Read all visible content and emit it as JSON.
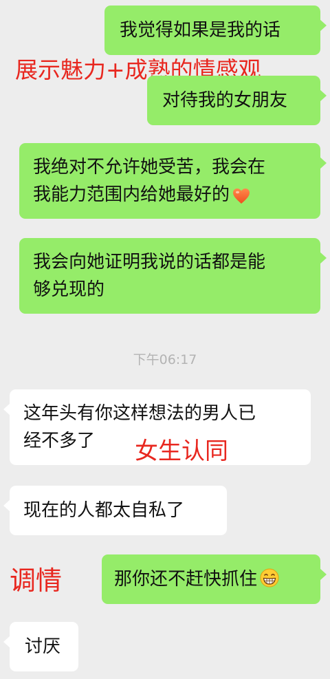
{
  "messages": [
    {
      "lines": [
        "我觉得如果是我的话"
      ]
    },
    {
      "lines": [
        "对待我的女朋友"
      ]
    },
    {
      "lines": [
        "我绝对不允许她受苦，我会在",
        "我能力范围内给她最好的"
      ],
      "emoji": "heart-icon"
    },
    {
      "lines": [
        "我会向她证明我说的话都是能",
        "够兑现的"
      ]
    },
    {
      "lines": [
        "这年头有你这样想法的男人已",
        "经不多了"
      ]
    },
    {
      "lines": [
        "现在的人都太自私了"
      ]
    },
    {
      "lines": [
        "那你还不赶快抓住"
      ],
      "emoji": "grinning-face-icon"
    },
    {
      "lines": [
        "讨厌"
      ]
    }
  ],
  "timestamp": "下午06:17",
  "annotations": {
    "charm": "展示魅力+成熟的情感观",
    "agree": "女生认同",
    "flirt": "调情"
  },
  "colors": {
    "sent_bubble": "#95ec69",
    "received_bubble": "#ffffff",
    "background": "#ededed",
    "annotation": "#e8271f",
    "timestamp": "#b3b3b3"
  }
}
